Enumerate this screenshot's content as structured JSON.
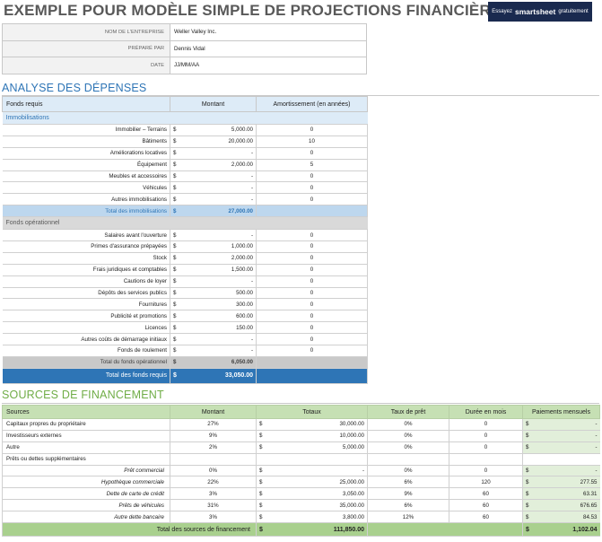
{
  "title": "EXEMPLE POUR MODÈLE SIMPLE DE PROJECTIONS FINANCIÈRES",
  "cta": {
    "pre": "Essayez",
    "brand": "smartsheet",
    "post": "gratuitement"
  },
  "info": [
    {
      "label": "NOM DE L'ENTREPRISE",
      "value": "Weller Valley Inc."
    },
    {
      "label": "PRÉPARÉ PAR",
      "value": "Dennis Vidal"
    },
    {
      "label": "DATE",
      "value": "JJ/MM/AA"
    }
  ],
  "expenses": {
    "section_title": "ANALYSE DES DÉPENSES",
    "headers": [
      "Fonds requis",
      "Montant",
      "Amortissement (en années)"
    ],
    "currency": "$",
    "fixed_group": "Immobilisations",
    "fixed": [
      {
        "label": "Immobilier – Terrains",
        "amount": "5,000.00",
        "years": "0"
      },
      {
        "label": "Bâtiments",
        "amount": "20,000.00",
        "years": "10"
      },
      {
        "label": "Améliorations locatives",
        "amount": "-",
        "years": "0"
      },
      {
        "label": "Équipement",
        "amount": "2,000.00",
        "years": "5"
      },
      {
        "label": "Meubles et accessoires",
        "amount": "-",
        "years": "0"
      },
      {
        "label": "Véhicules",
        "amount": "-",
        "years": "0"
      },
      {
        "label": "Autres immobilisations",
        "amount": "-",
        "years": "0"
      }
    ],
    "fixed_total": {
      "label": "Total des immobilisations",
      "amount": "27,000.00"
    },
    "operating_group": "Fonds opérationnel",
    "operating": [
      {
        "label": "Salaires avant l'ouverture",
        "amount": "-",
        "years": "0"
      },
      {
        "label": "Primes d'assurance prépayées",
        "amount": "1,000.00",
        "years": "0"
      },
      {
        "label": "Stock",
        "amount": "2,000.00",
        "years": "0"
      },
      {
        "label": "Frais juridiques et comptables",
        "amount": "1,500.00",
        "years": "0"
      },
      {
        "label": "Cautions de loyer",
        "amount": "-",
        "years": "0"
      },
      {
        "label": "Dépôts des services publics",
        "amount": "500.00",
        "years": "0"
      },
      {
        "label": "Fournitures",
        "amount": "300.00",
        "years": "0"
      },
      {
        "label": "Publicité et promotions",
        "amount": "600.00",
        "years": "0"
      },
      {
        "label": "Licences",
        "amount": "150.00",
        "years": "0"
      },
      {
        "label": "Autres coûts de démarrage initiaux",
        "amount": "-",
        "years": "0"
      },
      {
        "label": "Fonds de roulement",
        "amount": "-",
        "years": "0"
      }
    ],
    "operating_total": {
      "label": "Total du fonds opérationnel",
      "amount": "6,050.00"
    },
    "grand_total": {
      "label": "Total des fonds requis",
      "amount": "33,050.00"
    }
  },
  "financing": {
    "section_title": "SOURCES DE FINANCEMENT",
    "headers": [
      "Sources",
      "Montant",
      "Totaux",
      "Taux de prêt",
      "Durée en mois",
      "Paiements mensuels"
    ],
    "currency": "$",
    "rows": [
      {
        "label": "Capitaux propres du propriétaire",
        "pct": "27%",
        "total": "30,000.00",
        "rate": "0%",
        "months": "0",
        "payment": "-"
      },
      {
        "label": "Investisseurs externes",
        "pct": "9%",
        "total": "10,000.00",
        "rate": "0%",
        "months": "0",
        "payment": "-"
      },
      {
        "label": "Autre",
        "pct": "2%",
        "total": "5,000.00",
        "rate": "0%",
        "months": "0",
        "payment": "-"
      }
    ],
    "loans_label": "Prêts ou dettes supplémentaires",
    "loans": [
      {
        "label": "Prêt commercial",
        "pct": "0%",
        "total": "-",
        "rate": "0%",
        "months": "0",
        "payment": "-"
      },
      {
        "label": "Hypothèque commerciale",
        "pct": "22%",
        "total": "25,000.00",
        "rate": "6%",
        "months": "120",
        "payment": "277.55"
      },
      {
        "label": "Dette de carte de crédit",
        "pct": "3%",
        "total": "3,050.00",
        "rate": "9%",
        "months": "60",
        "payment": "63.31"
      },
      {
        "label": "Prêts de véhicules",
        "pct": "31%",
        "total": "35,000.00",
        "rate": "6%",
        "months": "60",
        "payment": "676.65"
      },
      {
        "label": "Autre dette bancaire",
        "pct": "3%",
        "total": "3,800.00",
        "rate": "12%",
        "months": "60",
        "payment": "84.53"
      }
    ],
    "total": {
      "label": "Total des sources de financement",
      "total": "111,850.00",
      "payment": "1,102.04"
    }
  }
}
